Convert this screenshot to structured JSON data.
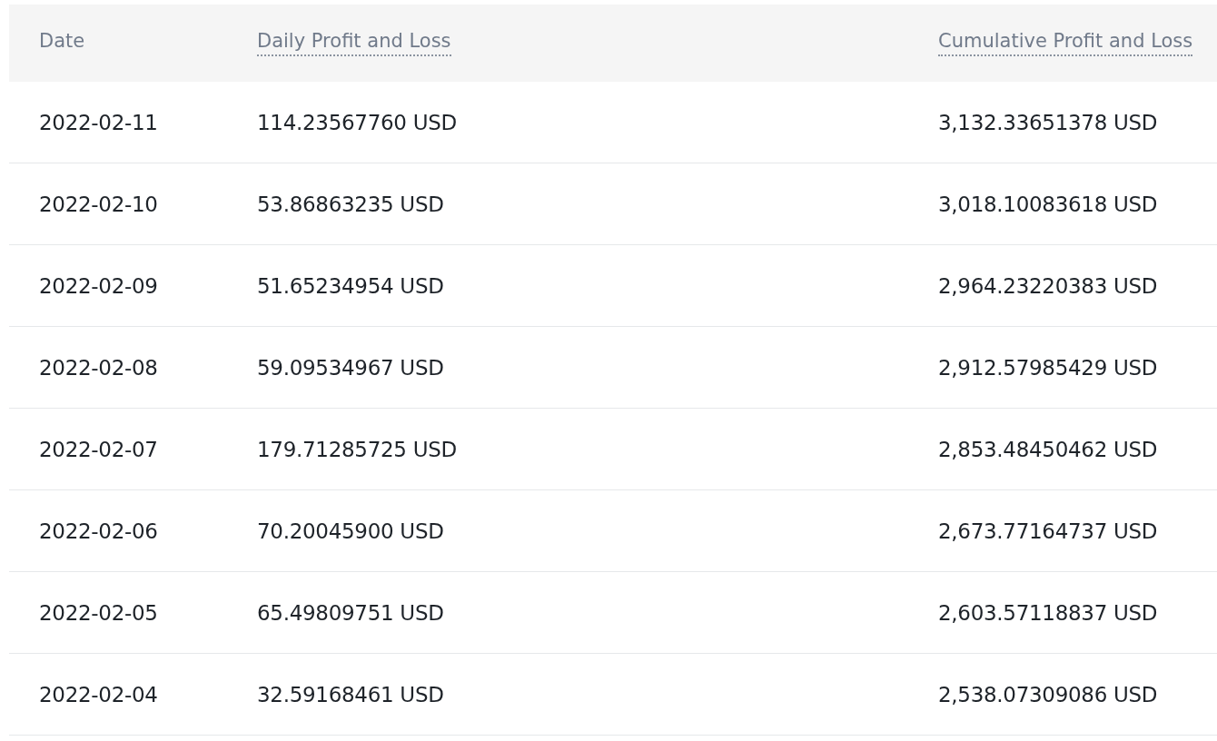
{
  "table": {
    "columns": [
      {
        "label": "Date",
        "dotted_underline": false
      },
      {
        "label": "Daily Profit and Loss",
        "dotted_underline": true
      },
      {
        "label": "Cumulative Profit and Loss",
        "dotted_underline": true
      }
    ],
    "rows": [
      [
        "2022-02-11",
        "114.23567760 USD",
        "3,132.33651378 USD"
      ],
      [
        "2022-02-10",
        "53.86863235 USD",
        "3,018.10083618 USD"
      ],
      [
        "2022-02-09",
        "51.65234954 USD",
        "2,964.23220383 USD"
      ],
      [
        "2022-02-08",
        "59.09534967 USD",
        "2,912.57985429 USD"
      ],
      [
        "2022-02-07",
        "179.71285725 USD",
        "2,853.48450462 USD"
      ],
      [
        "2022-02-06",
        "70.20045900 USD",
        "2,673.77164737 USD"
      ],
      [
        "2022-02-05",
        "65.49809751 USD",
        "2,603.57118837 USD"
      ],
      [
        "2022-02-04",
        "32.59168461 USD",
        "2,538.07309086 USD"
      ]
    ]
  }
}
